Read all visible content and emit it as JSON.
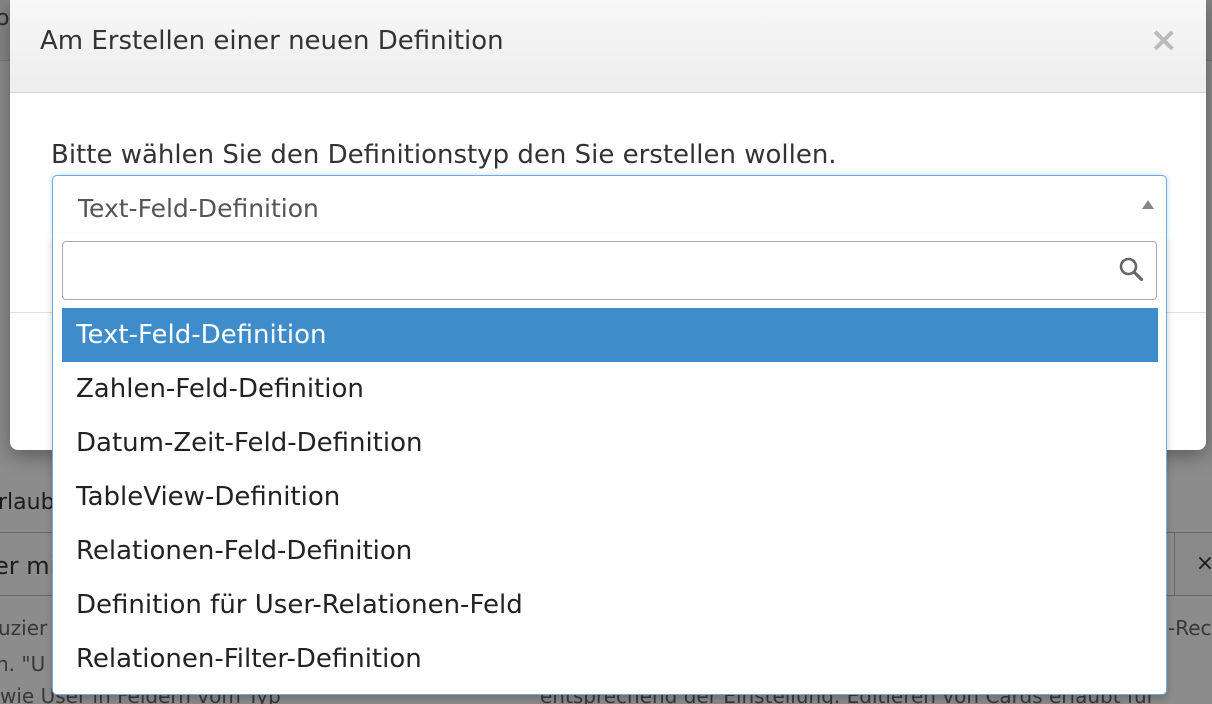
{
  "background": {
    "top_fragment": "o",
    "left_fragment": "rlaub",
    "input_fragment": "er mit",
    "input_button": "×",
    "text_lines_left": [
      "uzier",
      "n. \"U",
      "wie User in Feldern vom Typ"
    ],
    "text_lines_right": [
      "-Rec",
      "entsprechend der Einstellung. Editieren von Cards erlaubt für"
    ]
  },
  "modal": {
    "title": "Am Erstellen einer neuen Definition",
    "close_label": "×",
    "prompt": "Bitte wählen Sie den Definitionstyp den Sie erstellen wollen."
  },
  "select": {
    "value": "Text-Feld-Definition",
    "search_value": "",
    "search_placeholder": "",
    "options": [
      {
        "label": "Text-Feld-Definition",
        "selected": true
      },
      {
        "label": "Zahlen-Feld-Definition",
        "selected": false
      },
      {
        "label": "Datum-Zeit-Feld-Definition",
        "selected": false
      },
      {
        "label": "TableView-Definition",
        "selected": false
      },
      {
        "label": "Relationen-Feld-Definition",
        "selected": false
      },
      {
        "label": "Definition für User-Relationen-Feld",
        "selected": false
      },
      {
        "label": "Relationen-Filter-Definition",
        "selected": false
      }
    ]
  },
  "icons": {
    "search": "search-icon",
    "arrow": "caret-up-icon",
    "close": "close-icon"
  },
  "colors": {
    "highlight": "#3f8ccb",
    "focus_border": "#72a9dc"
  }
}
